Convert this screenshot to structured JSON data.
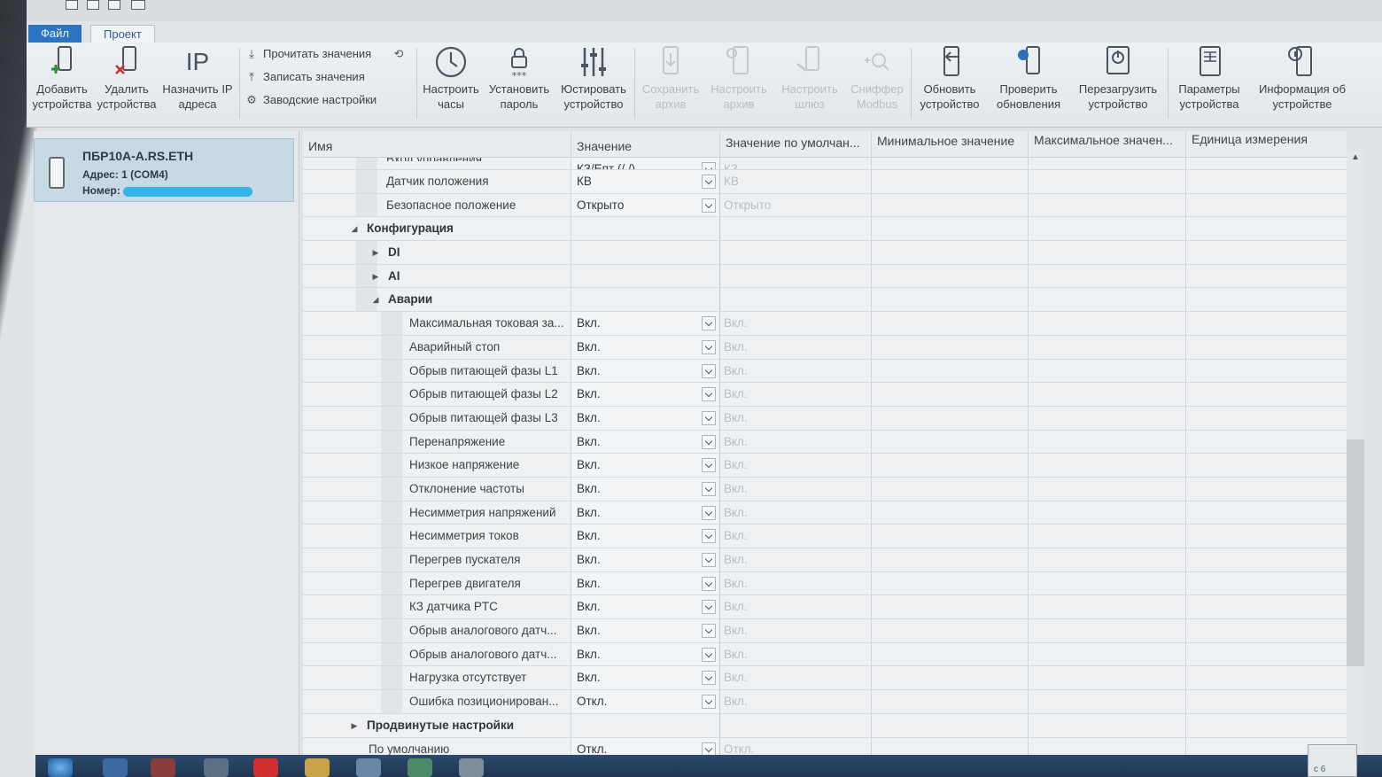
{
  "ribbon_tabs": {
    "file": "Файл",
    "project": "Проект"
  },
  "ribbon": {
    "add_devices": "Добавить\nустройства",
    "remove_devices": "Удалить\nустройства",
    "assign_ip": "Назначить IP\nадреса",
    "assign_ip_glyph": "IP",
    "read_values": "Прочитать значения",
    "write_values": "Записать значения",
    "factory_settings": "Заводские настройки",
    "set_clock": "Настроить\nчасы",
    "set_password": "Установить\nпароль",
    "adjust_device": "Юстировать\nустройство",
    "save_archive": "Сохранить\nархив",
    "configure_archive": "Настроить\nархив",
    "configure_gateway": "Настроить\nшлюз",
    "modbus_sniffer": "Сниффер\nModbus",
    "update_device": "Обновить\nустройство",
    "check_updates": "Проверить\nобновления",
    "reboot_device": "Перезагрузить\nустройство",
    "device_params": "Параметры\nустройства",
    "device_info": "Информация об\nустройстве"
  },
  "device": {
    "name": "ПБР10А-A.RS.ETH",
    "address": "Адрес: 1 (COM4)",
    "number_label": "Номер:"
  },
  "grid_headers": {
    "name": "Имя",
    "value": "Значение",
    "default": "Значение по умолчан...",
    "min": "Минимальное значение",
    "max": "Максимальное значен...",
    "unit": "Единица измерения"
  },
  "rows": [
    {
      "name": "Вход управления",
      "value": "КЗ/Епт (/ /)",
      "default": "КЗ",
      "level": 2,
      "dropdown": true,
      "partial": true
    },
    {
      "name": "Датчик положения",
      "value": "КВ",
      "default": "КВ",
      "level": 2,
      "dropdown": true
    },
    {
      "name": "Безопасное положение",
      "value": "Открыто",
      "default": "Открыто",
      "level": 2,
      "dropdown": true
    },
    {
      "name": "Конфигурация",
      "level": 0,
      "group": true,
      "expander": "expanded"
    },
    {
      "name": "DI",
      "level": 1,
      "group": true,
      "expander": "collapsed"
    },
    {
      "name": "AI",
      "level": 1,
      "group": true,
      "expander": "collapsed"
    },
    {
      "name": "Аварии",
      "level": 1,
      "group": true,
      "expander": "expanded"
    },
    {
      "name": "Максимальная токовая за...",
      "value": "Вкл.",
      "default": "Вкл.",
      "level": 3,
      "dropdown": true
    },
    {
      "name": "Аварийный стоп",
      "value": "Вкл.",
      "default": "Вкл.",
      "level": 3,
      "dropdown": true
    },
    {
      "name": "Обрыв питающей фазы L1",
      "value": "Вкл.",
      "default": "Вкл.",
      "level": 3,
      "dropdown": true
    },
    {
      "name": "Обрыв питающей фазы L2",
      "value": "Вкл.",
      "default": "Вкл.",
      "level": 3,
      "dropdown": true
    },
    {
      "name": "Обрыв питающей фазы L3",
      "value": "Вкл.",
      "default": "Вкл.",
      "level": 3,
      "dropdown": true
    },
    {
      "name": "Перенапряжение",
      "value": "Вкл.",
      "default": "Вкл.",
      "level": 3,
      "dropdown": true
    },
    {
      "name": "Низкое напряжение",
      "value": "Вкл.",
      "default": "Вкл.",
      "level": 3,
      "dropdown": true
    },
    {
      "name": "Отклонение частоты",
      "value": "Вкл.",
      "default": "Вкл.",
      "level": 3,
      "dropdown": true
    },
    {
      "name": "Несимметрия напряжений",
      "value": "Вкл.",
      "default": "Вкл.",
      "level": 3,
      "dropdown": true
    },
    {
      "name": "Несимметрия токов",
      "value": "Вкл.",
      "default": "Вкл.",
      "level": 3,
      "dropdown": true
    },
    {
      "name": "Перегрев пускателя",
      "value": "Вкл.",
      "default": "Вкл.",
      "level": 3,
      "dropdown": true
    },
    {
      "name": "Перегрев двигателя",
      "value": "Вкл.",
      "default": "Вкл.",
      "level": 3,
      "dropdown": true
    },
    {
      "name": "КЗ датчика PTC",
      "value": "Вкл.",
      "default": "Вкл.",
      "level": 3,
      "dropdown": true
    },
    {
      "name": "Обрыв аналогового датч...",
      "value": "Вкл.",
      "default": "Вкл.",
      "level": 3,
      "dropdown": true
    },
    {
      "name": "Обрыв аналогового датч...",
      "value": "Вкл.",
      "default": "Вкл.",
      "level": 3,
      "dropdown": true
    },
    {
      "name": "Нагрузка отсутствует",
      "value": "Вкл.",
      "default": "Вкл.",
      "level": 3,
      "dropdown": true
    },
    {
      "name": "Ошибка позиционирован...",
      "value": "Откл.",
      "default": "Вкл.",
      "level": 3,
      "dropdown": true
    },
    {
      "name": "Продвинутые настройки",
      "level": 0,
      "group": true,
      "expander": "collapsed"
    },
    {
      "name": "По умолчанию",
      "value": "Откл.",
      "default": "Откл.",
      "level": 0,
      "dropdown": true
    }
  ],
  "colors": {
    "file_tab": "#2c74c2",
    "device_selected": "#c8d9e6",
    "number_redaction": "#33b3e8"
  },
  "tray_text": "с 6"
}
